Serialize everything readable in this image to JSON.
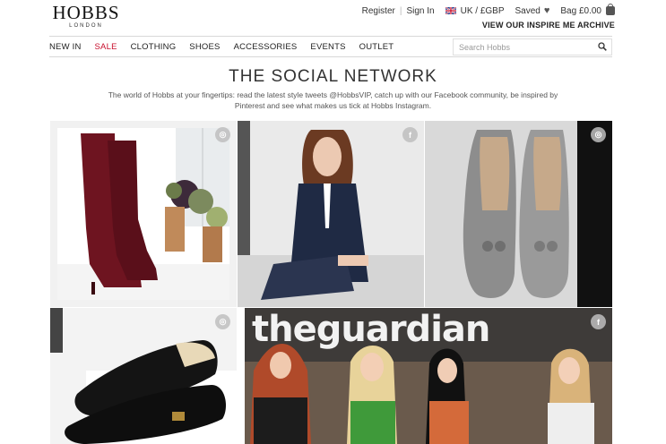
{
  "logo": {
    "brand": "HOBBS",
    "sub": "LONDON"
  },
  "utility": {
    "register": "Register",
    "sign_in": "Sign In",
    "region": "UK / £GBP",
    "saved": "Saved",
    "bag": "Bag £0.00"
  },
  "inspire_link": "VIEW OUR INSPIRE ME ARCHIVE",
  "nav": {
    "items": [
      {
        "label": "NEW IN"
      },
      {
        "label": "SALE"
      },
      {
        "label": "CLOTHING"
      },
      {
        "label": "SHOES"
      },
      {
        "label": "ACCESSORIES"
      },
      {
        "label": "EVENTS"
      },
      {
        "label": "OUTLET"
      }
    ],
    "search_placeholder": "Search Hobbs"
  },
  "page": {
    "title": "THE SOCIAL NETWORK",
    "intro": "The world of Hobbs at your fingertips: read the latest style tweets @HobbsVIP, catch up with our Facebook community, be inspired by Pinterest and see what makes us tick at Hobbs Instagram."
  },
  "tiles": {
    "tile1_icon": "instagram-icon",
    "tile2_icon": "facebook-icon",
    "tile2_glyph": "f",
    "tile3_icon": "instagram-icon",
    "tile4_icon": "instagram-icon",
    "tile5_icon": "facebook-icon",
    "tile5_glyph": "f",
    "tile5_sign": "theguardian"
  },
  "colors": {
    "sale": "#c8102e",
    "burgundy": "#6e1420",
    "navy": "#1f2a44"
  }
}
